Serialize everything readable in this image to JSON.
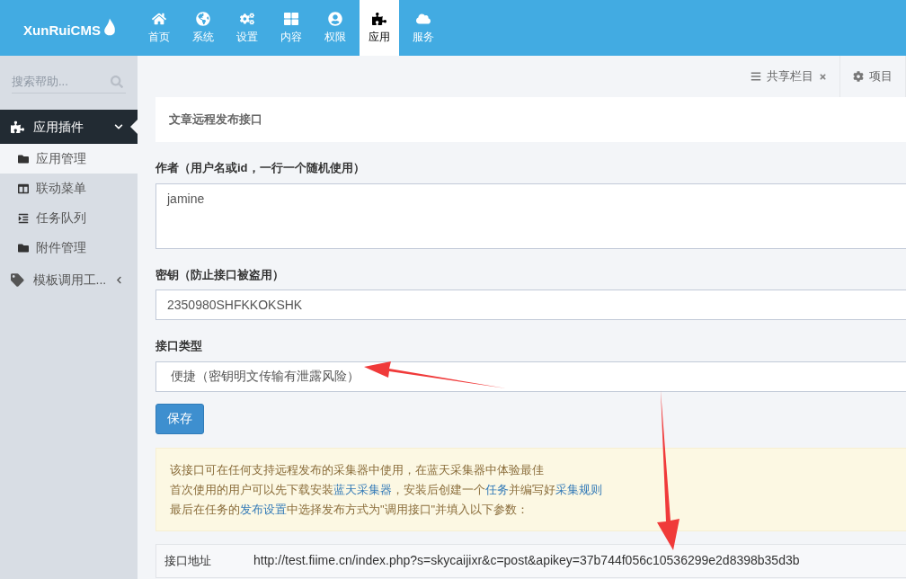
{
  "logo": {
    "text": "XunRuiCMS"
  },
  "nav": [
    {
      "label": "首页",
      "selected": false
    },
    {
      "label": "系统",
      "selected": false
    },
    {
      "label": "设置",
      "selected": false
    },
    {
      "label": "内容",
      "selected": false
    },
    {
      "label": "权限",
      "selected": false
    },
    {
      "label": "应用",
      "selected": true
    },
    {
      "label": "服务",
      "selected": false
    }
  ],
  "sidebar": {
    "search": {
      "placeholder": "搜索帮助..."
    },
    "groups": [
      {
        "label": "应用插件",
        "expanded": true,
        "children": [
          {
            "label": "应用管理",
            "selected": true
          },
          {
            "label": "联动菜单",
            "selected": false
          },
          {
            "label": "任务队列",
            "selected": false
          },
          {
            "label": "附件管理",
            "selected": false
          }
        ]
      },
      {
        "label": "模板调用工...",
        "expanded": false
      }
    ]
  },
  "top_tabs": [
    {
      "label": "共享栏目",
      "closable": true
    },
    {
      "label": "项目",
      "closable": false
    }
  ],
  "page_title": "文章远程发布接口",
  "form": [
    {
      "kind": "textarea",
      "label": "作者（用户名或id，一行一个随机使用）",
      "value": "jamine"
    },
    {
      "kind": "input",
      "label": "密钥（防止接口被盗用）",
      "value": "2350980SHFKKOKSHK"
    },
    {
      "kind": "select",
      "label": "接口类型",
      "value": "便捷（密钥明文传输有泄露风险）"
    }
  ],
  "save_button": "保存",
  "notice": [
    [
      {
        "text": "该接口可在任何支持远程发布的采集器中使用，在蓝天采集器中体验最佳",
        "link": false
      }
    ],
    [
      {
        "text": "首次使用的用户可以先下载安装",
        "link": false
      },
      {
        "text": "蓝天采集器",
        "link": true
      },
      {
        "text": "，安装后创建一个",
        "link": false
      },
      {
        "text": "任务",
        "link": true
      },
      {
        "text": "并编写好",
        "link": false
      },
      {
        "text": "采集规则",
        "link": true
      }
    ],
    [
      {
        "text": "最后在任务的",
        "link": false
      },
      {
        "text": "发布设置",
        "link": true
      },
      {
        "text": "中选择发布方式为\"调用接口\"并填入以下参数：",
        "link": false
      }
    ]
  ],
  "params": [
    {
      "name": "接口地址",
      "value": "http://test.fiime.cn/index.php?s=skycaijixr&c=post&apikey=37b744f056c10536299e2d8398b35d3b"
    }
  ]
}
